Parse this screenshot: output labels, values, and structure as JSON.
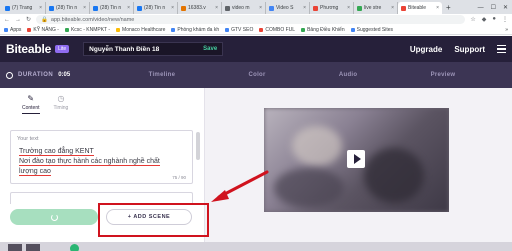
{
  "browser": {
    "tabs": [
      {
        "label": "(7) Trang",
        "color": "#1877f2"
      },
      {
        "label": "(28) Tin n",
        "color": "#1877f2"
      },
      {
        "label": "(28) Tin n",
        "color": "#1877f2"
      },
      {
        "label": "(28) Tin n",
        "color": "#1877f2"
      },
      {
        "label": "16383.v",
        "color": "#e37400"
      },
      {
        "label": "video m",
        "color": "#5f6368"
      },
      {
        "label": "Video S",
        "color": "#4285f4"
      },
      {
        "label": "Phương",
        "color": "#ea4335"
      },
      {
        "label": "live stre",
        "color": "#34a853"
      },
      {
        "label": "Biteable",
        "color": "#ea4335"
      }
    ],
    "new_tab": "+",
    "window_controls": [
      "—",
      "☐",
      "✕"
    ],
    "url": "app.biteable.com/video/new/name",
    "bookmarks": [
      {
        "label": "Apps",
        "color": "#4285f4"
      },
      {
        "label": "KỸ NĂNG -",
        "color": "#ea4335"
      },
      {
        "label": "Kcsc - KNMPKT -",
        "color": "#34a853"
      },
      {
        "label": "Monaco Healthcare",
        "color": "#fbbc05"
      },
      {
        "label": "Phòng khám đa kh",
        "color": "#4285f4"
      },
      {
        "label": "GTV SEO",
        "color": "#4285f4"
      },
      {
        "label": "COMBO FUL",
        "color": "#ea4335"
      },
      {
        "label": "Bảng Điều Khiển",
        "color": "#34a853"
      },
      {
        "label": "Suggested Sites",
        "color": "#4285f4"
      }
    ],
    "bookmark_overflow": "»"
  },
  "app": {
    "logo": "Biteable",
    "badge": "Lite",
    "project_name": "Nguyễn Thanh Điền 18",
    "save_label": "Save",
    "nav": {
      "upgrade": "Upgrade",
      "support": "Support"
    },
    "duration_label": "DURATION",
    "duration_value": "0:05",
    "steps": [
      "Timeline",
      "Color",
      "Audio",
      "Preview"
    ]
  },
  "editor": {
    "tabs": [
      {
        "label": "Content",
        "icon": "pencil-icon"
      },
      {
        "label": "Timing",
        "icon": "stopwatch-icon"
      }
    ],
    "text_label": "Your text",
    "text_lines": [
      "Trường cao đẳng KENT",
      "Nơi đào tạo thực hành các nghành nghề chất",
      "lượng cao"
    ],
    "char_counter": "75 / 90",
    "add_scene_label": "+  ADD SCENE"
  },
  "colors": {
    "header_bg": "#26203a",
    "stepbar_bg": "#3c3554",
    "accent_green": "#a7dfbf",
    "annotation_red": "#d0131e"
  }
}
